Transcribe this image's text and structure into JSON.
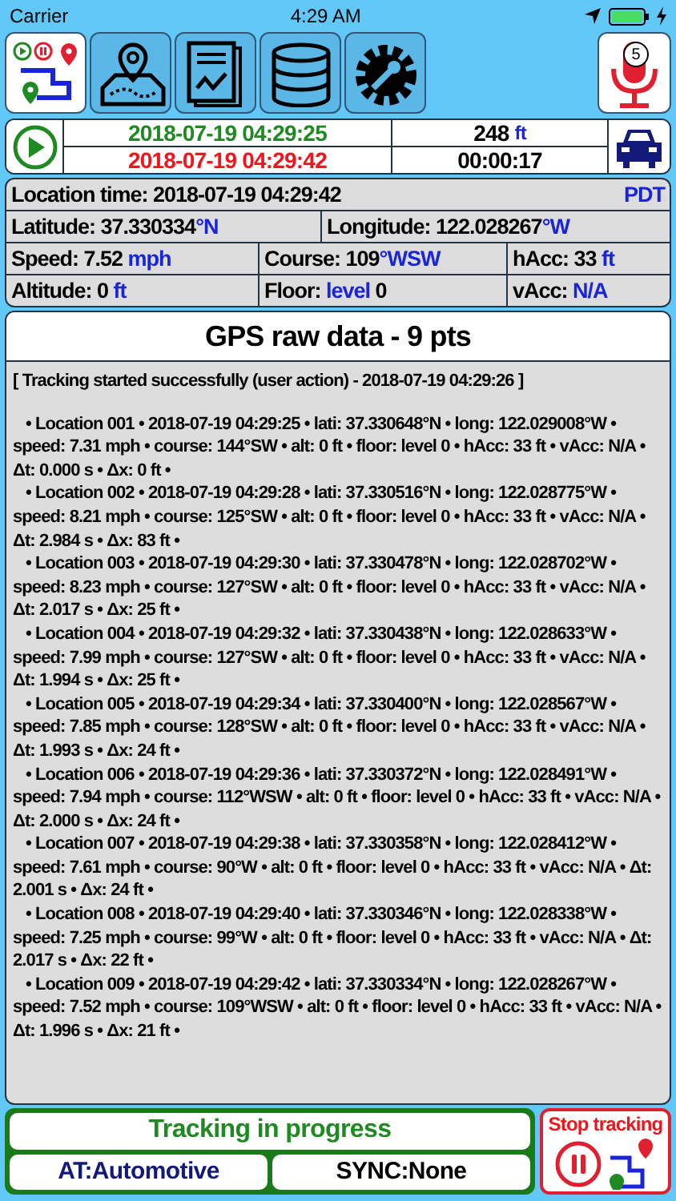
{
  "status_bar": {
    "carrier": "Carrier",
    "time": "4:29 AM"
  },
  "toolbar": {
    "items": [
      {
        "kind": "track",
        "selected": true
      },
      {
        "kind": "map",
        "selected": false
      },
      {
        "kind": "report",
        "selected": false
      },
      {
        "kind": "database",
        "selected": false
      },
      {
        "kind": "settings",
        "selected": false
      }
    ],
    "mic": {
      "badge": "5"
    }
  },
  "session": {
    "start_time": "2018-07-19 04:29:25",
    "end_time": "2018-07-19 04:29:42",
    "distance": "248",
    "distance_unit": "ft",
    "duration": "00:00:17"
  },
  "location": {
    "rows": [
      [
        {
          "parts": [
            {
              "text": "Location time: 2018-07-19 04:29:42",
              "accent": false
            }
          ],
          "end": "PDT"
        }
      ],
      [
        {
          "parts": [
            {
              "text": "Latitude: 37.330334",
              "accent": false
            },
            {
              "text": "°N",
              "accent": true
            }
          ]
        },
        {
          "parts": [
            {
              "text": "Longitude: 122.028267",
              "accent": false
            },
            {
              "text": "°W",
              "accent": true
            }
          ]
        }
      ],
      [
        {
          "parts": [
            {
              "text": "Speed: 7.52 ",
              "accent": false
            },
            {
              "text": "mph",
              "accent": true
            }
          ]
        },
        {
          "parts": [
            {
              "text": "Course: 109",
              "accent": false
            },
            {
              "text": "°WSW",
              "accent": true
            }
          ]
        },
        {
          "parts": [
            {
              "text": "hAcc: 33 ",
              "accent": false
            },
            {
              "text": "ft",
              "accent": true
            }
          ]
        }
      ],
      [
        {
          "parts": [
            {
              "text": "Altitude: 0 ",
              "accent": false
            },
            {
              "text": "ft",
              "accent": true
            }
          ]
        },
        {
          "parts": [
            {
              "text": "Floor: ",
              "accent": false
            },
            {
              "text": "level",
              "accent": true
            },
            {
              "text": " 0",
              "accent": false
            }
          ]
        },
        {
          "parts": [
            {
              "text": "vAcc: ",
              "accent": false
            },
            {
              "text": "N/A",
              "accent": true
            }
          ]
        }
      ]
    ]
  },
  "log": {
    "title": "GPS raw data - 9 pts",
    "notice": "[ Tracking started successfully (user action) - 2018-07-19 04:29:26 ]",
    "entries": [
      "• Location 001 • 2018-07-19 04:29:25 • lati: 37.330648°N • long: 122.029008°W • speed: 7.31 mph • course: 144°SW  • alt: 0 ft • floor: level 0 • hAcc: 33 ft • vAcc: N/A • Δt: 0.000 s • Δx: 0 ft •",
      "• Location 002 • 2018-07-19 04:29:28 • lati: 37.330516°N • long: 122.028775°W • speed: 8.21 mph • course: 125°SW  • alt: 0 ft • floor: level 0 • hAcc: 33 ft • vAcc: N/A • Δt: 2.984 s • Δx: 83 ft •",
      "• Location 003 • 2018-07-19 04:29:30 • lati: 37.330478°N • long: 122.028702°W • speed: 8.23 mph • course: 127°SW  • alt: 0 ft • floor: level 0 • hAcc: 33 ft • vAcc: N/A • Δt: 2.017 s • Δx: 25 ft •",
      "• Location 004 • 2018-07-19 04:29:32 • lati: 37.330438°N • long: 122.028633°W • speed: 7.99 mph • course: 127°SW  • alt: 0 ft • floor: level 0 • hAcc: 33 ft • vAcc: N/A • Δt: 1.994 s • Δx: 25 ft •",
      "• Location 005 • 2018-07-19 04:29:34 • lati: 37.330400°N • long: 122.028567°W • speed: 7.85 mph • course: 128°SW  • alt: 0 ft • floor: level 0 • hAcc: 33 ft • vAcc: N/A • Δt: 1.993 s • Δx: 24 ft •",
      "• Location 006 • 2018-07-19 04:29:36 • lati: 37.330372°N • long: 122.028491°W • speed: 7.94 mph • course: 112°WSW • alt: 0 ft • floor: level 0 • hAcc: 33 ft • vAcc: N/A • Δt: 2.000 s • Δx: 24 ft •",
      "• Location 007 • 2018-07-19 04:29:38 • lati: 37.330358°N • long: 122.028412°W • speed: 7.61 mph • course: 90°W   • alt: 0 ft • floor: level 0 • hAcc: 33 ft • vAcc: N/A • Δt: 2.001 s • Δx: 24 ft •",
      "• Location 008 • 2018-07-19 04:29:40 • lati: 37.330346°N • long: 122.028338°W • speed: 7.25 mph • course: 99°W   • alt: 0 ft • floor: level 0 • hAcc: 33 ft • vAcc: N/A • Δt: 2.017 s • Δx: 22 ft •",
      "• Location 009 • 2018-07-19 04:29:42 • lati: 37.330334°N • long: 122.028267°W • speed: 7.52 mph • course: 109°WSW • alt: 0 ft • floor: level 0 • hAcc: 33 ft • vAcc: N/A • Δt: 1.996 s • Δx: 21 ft •"
    ]
  },
  "footer": {
    "state": "Tracking in progress",
    "activity": "AT:Automotive",
    "sync": "SYNC:None",
    "stop_button": "Stop tracking"
  }
}
